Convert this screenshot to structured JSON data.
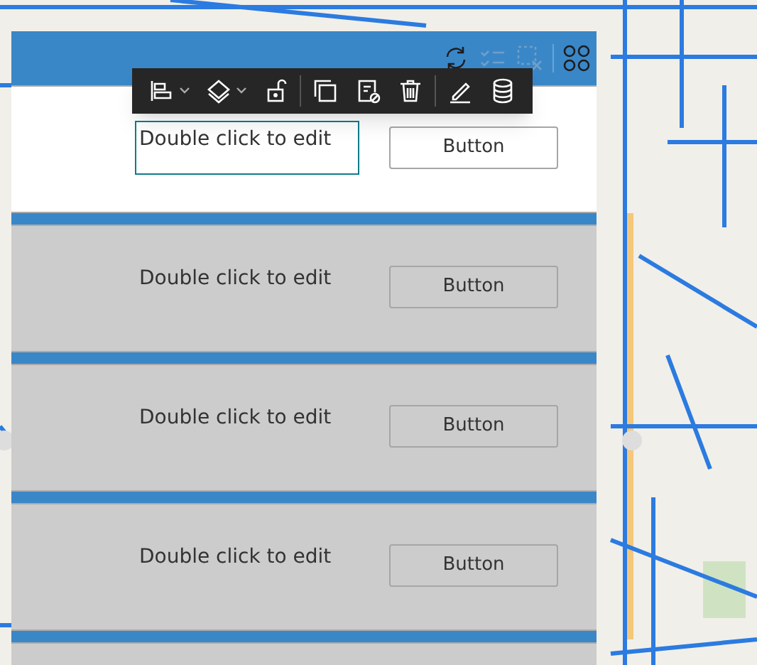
{
  "header_tools": [
    {
      "kind": "refresh",
      "disabled": false
    },
    {
      "kind": "checklist",
      "disabled": true
    },
    {
      "kind": "deselect",
      "disabled": true
    },
    {
      "kind": "grid",
      "disabled": false
    }
  ],
  "toolbar": [
    {
      "kind": "align",
      "dropdown": true
    },
    {
      "kind": "layers",
      "dropdown": true
    },
    {
      "kind": "unlock",
      "dropdown": false
    },
    {
      "kind": "duplicate",
      "dropdown": false
    },
    {
      "kind": "hide",
      "dropdown": false
    },
    {
      "kind": "delete",
      "dropdown": false
    },
    {
      "kind": "edit",
      "dropdown": false
    },
    {
      "kind": "data",
      "dropdown": false
    }
  ],
  "rows": [
    {
      "selected": true,
      "text": "Double click to edit",
      "button": "Button"
    },
    {
      "selected": false,
      "text": "Double click to edit",
      "button": "Button"
    },
    {
      "selected": false,
      "text": "Double click to edit",
      "button": "Button"
    },
    {
      "selected": false,
      "text": "Double click to edit",
      "button": "Button"
    }
  ]
}
